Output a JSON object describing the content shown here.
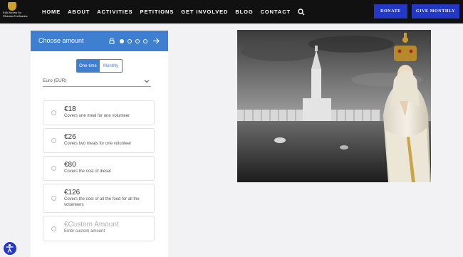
{
  "brand": {
    "logo_lines": [
      "Irish Society for",
      "Christian Civilization"
    ]
  },
  "nav": {
    "links": [
      "HOME",
      "ABOUT",
      "ACTIVITIES",
      "PETITIONS",
      "GET INVOLVED",
      "BLOG",
      "CONTACT"
    ],
    "search_icon": "search-icon",
    "donate_label": "DONATE",
    "monthly_label": "GIVE MONTHLY"
  },
  "form": {
    "title": "Choose amount",
    "steps_total": 4,
    "step_current": 1,
    "frequency": {
      "options": [
        "One-time",
        "Monthly"
      ],
      "selected": "One-time"
    },
    "currency": "Euro (EUR)",
    "amounts": [
      {
        "amount": "€18",
        "description": "Covers one meal for one volunteer"
      },
      {
        "amount": "€26",
        "description": "Covers two meals for one volunteer"
      },
      {
        "amount": "€80",
        "description": "Covers the cost of diesel"
      },
      {
        "amount": "€126",
        "description": "Covers the cost of all the food for all the volunteers"
      }
    ],
    "custom": {
      "placeholder": "€Custom Amount",
      "description": "Enter custom amount"
    }
  },
  "colors": {
    "nav_bg": "#111111",
    "button_blue": "#2438c6",
    "card_header": "#3f7fd0",
    "page_bg": "#f2f2f4"
  }
}
